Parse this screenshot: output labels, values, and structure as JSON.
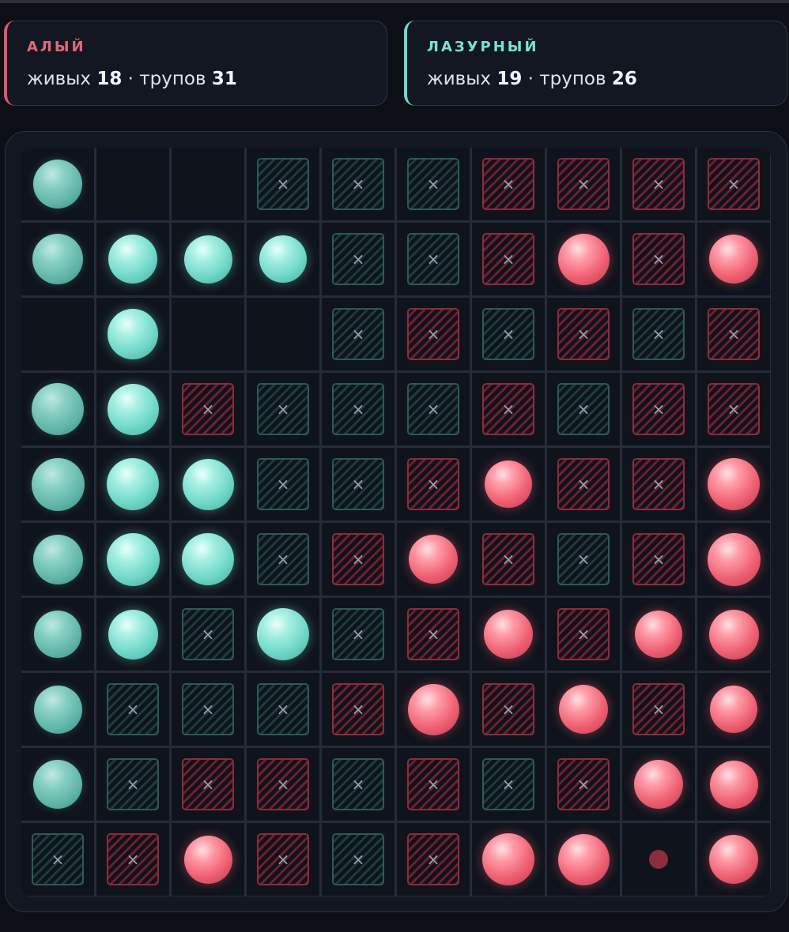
{
  "players": [
    {
      "name": "АЛЫЙ",
      "alive_label": "живых",
      "alive": "18",
      "separator": "·",
      "dead_label": "трупов",
      "dead": "31",
      "color": "#e0566d"
    },
    {
      "name": "ЛАЗУРНЫЙ",
      "alive_label": "живых",
      "alive": "19",
      "separator": "·",
      "dead_label": "трупов",
      "dead": "26",
      "color": "#6fd8c8"
    }
  ],
  "legend": {
    "A": "teal-piece",
    "a": "teal-piece-dim",
    "B": "red-piece",
    "X": "teal-corpse",
    "Y": "red-corpse",
    ".": "empty",
    "d": "red-marker"
  },
  "board": [
    "a..XXXYYYY",
    "aAAAXXYBYB",
    ".A..XYXYXY",
    "aAYXXXYXYY",
    "aAAXXYBYYB",
    "aAAXYBYXYB",
    "aAXAXYBYBB",
    "aXXXYBYBYB",
    "aXYYXYXYBB",
    "XYBYXYBBdB"
  ],
  "corpse_glyph": "×",
  "colors": {
    "red": "#ef5f72",
    "teal": "#6fd8c8",
    "background": "#0c0f15"
  }
}
